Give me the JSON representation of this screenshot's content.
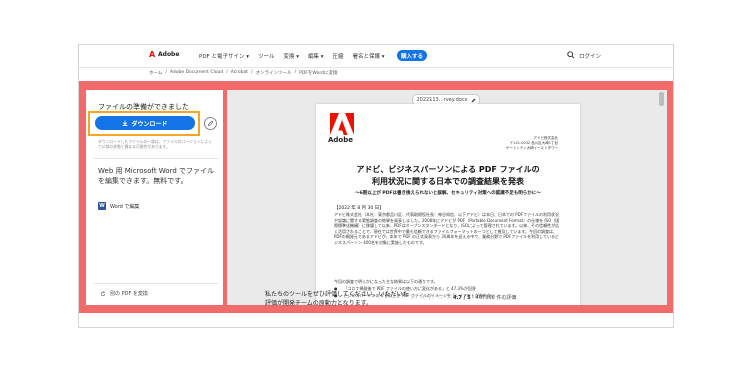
{
  "header": {
    "brand": "Adobe",
    "logo_glyph": "A",
    "nav": [
      "PDF と電子サイン ▾",
      "ツール",
      "変換 ▾",
      "編集 ▾",
      "圧縮",
      "署名と保護 ▾"
    ],
    "buy_label": "購入する",
    "login_label": "ログイン"
  },
  "breadcrumb": [
    "ホーム",
    "/",
    "Adobe Document Cloud",
    "/",
    "Acrobat",
    "/",
    "オンラインツール",
    "/",
    "PDFをWordに変換"
  ],
  "left_panel": {
    "ready_text": "ファイルの準備ができました",
    "download_label": "ダウンロード",
    "note": "ダウンロードしたファイルの一部は、ファイルのバージョンによって以前の状態と異なる可能性があります。",
    "word_promo": "Web 用 Microsoft Word でファイルを編集できます。無料です。",
    "word_edit_label": "Word で編集",
    "word_icon_glyph": "W",
    "convert_another_label": "別の PDF を変換"
  },
  "viewer": {
    "filename": "2022113‥·rvey.docx",
    "doc": {
      "logo_glyph": "A",
      "brand": "Adobe",
      "address": [
        "アドビ株式会社",
        "〒141-0032 品川区大崎1丁目",
        "ゲートシティ大崎イーストタワー"
      ],
      "title_line1": "アドビ、ビジネスパーソンによる PDF ファイルの",
      "title_line2": "利用状況に関する日本での調査結果を発表",
      "subtitle": "～6割以上が PDFは書き換えられないと誤解、セキュリティ対策への認識不足も明らかに～",
      "date": "【2022 年 8 月 30 日】",
      "para1": "アドビ株式会社（本社：東京都品川区、代表取締役社長：神谷知信、以下アドビ）は本日、日本での PDFファイルの利用状況や認識に関する実態調査の結果を発表しました。2008年にアドビが PDF（Portable Document Format）の仕様を ISO（国際標準化機構）に移譲して以来、PDFはオープンスタンダードとなり、ISOによって管理されています。以来、その信頼性が広く活用されることで、現在では世界中で最も信頼できるファイルフォーマットの一つとして普及しています。今回の調査は、PDFの開発元であるアドビが、本年で PDF の正式発表から 30周年を迎える中で、業務分野で PDFファイルを利用しているビジネスパーソン 400名を対象に実施したものです。",
      "para2": "今回の調査で明らかになった主な結果は以下の通りです。",
      "bullet1": "「コロナ禍前後で PDF ファイルの使い方に変化がある」と 47.3%が回答",
      "bullet2": "ビジネスパーソンの 6 割以上が PDF ファイルのイメージを「レイアウトが崩れない"
    }
  },
  "rating": {
    "prompt_line1": "私たちのツールをぜひ評価してください。いただいた",
    "prompt_line2": "評価が開発チームの原動力となります。",
    "score": "4.7 / 5",
    "count_text": "- 407356 件の評価",
    "star_glyph": "☆"
  },
  "colors": {
    "accent": "#1473e6",
    "brand_red": "#eb1000",
    "background_band": "#f26b6b",
    "highlight": "#f5a623"
  }
}
